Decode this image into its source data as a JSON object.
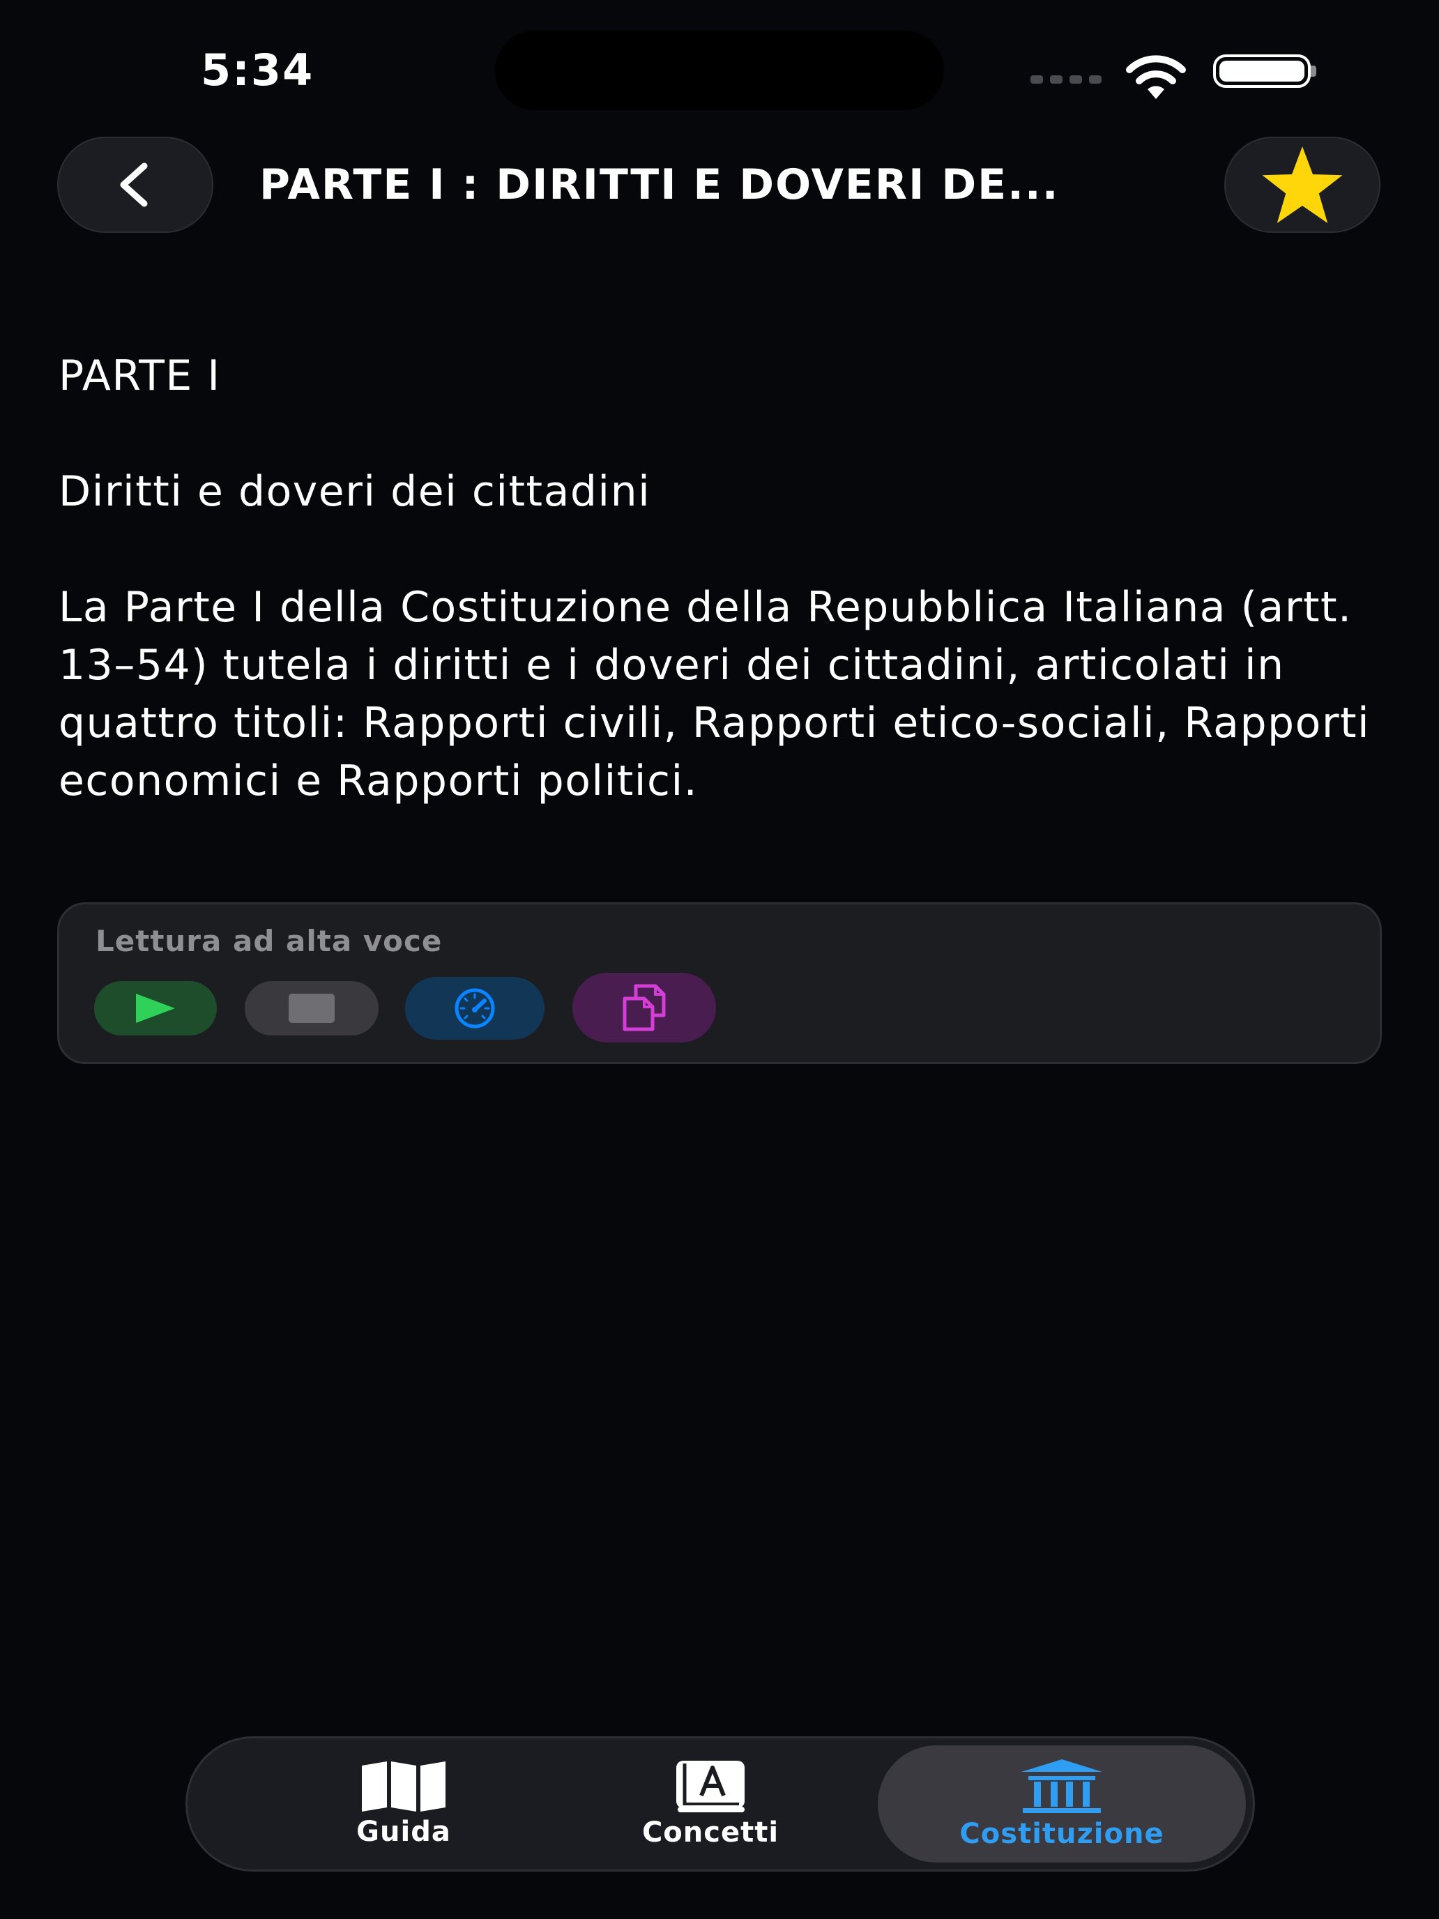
{
  "status_bar": {
    "time": "5:34"
  },
  "nav": {
    "title": "PARTE I : DIRITTI E DOVERI DE...",
    "back_icon": "chevron-left-icon",
    "favorite_icon": "star-icon",
    "favorite_color": "#FFD60A"
  },
  "content": {
    "heading": "PARTE I",
    "subheading": "Diritti e doveri dei cittadini",
    "body": "La Parte I della Costituzione della Repubblica Italiana (artt. 13–54) tutela i diritti e i doveri dei cittadini, articolati in quattro titoli: Rapporti civili, Rapporti etico-sociali, Rapporti economici e Rapporti politici."
  },
  "tts": {
    "label": "Lettura ad alta voce",
    "buttons": [
      {
        "name": "play",
        "icon": "play-icon",
        "color": "#30D158"
      },
      {
        "name": "stop",
        "icon": "stop-icon",
        "color": "#6e6e73"
      },
      {
        "name": "speed",
        "icon": "speedometer-icon",
        "color": "#0A84FF"
      },
      {
        "name": "copy",
        "icon": "copy-icon",
        "color": "#D33FD6"
      }
    ]
  },
  "tab_bar": {
    "active": "Costituzione",
    "accent_color": "#2F9DF2",
    "items": [
      {
        "label": "Guida",
        "icon": "map-icon"
      },
      {
        "label": "Concetti",
        "icon": "dictionary-icon"
      },
      {
        "label": "Costituzione",
        "icon": "building-columns-icon"
      }
    ]
  }
}
